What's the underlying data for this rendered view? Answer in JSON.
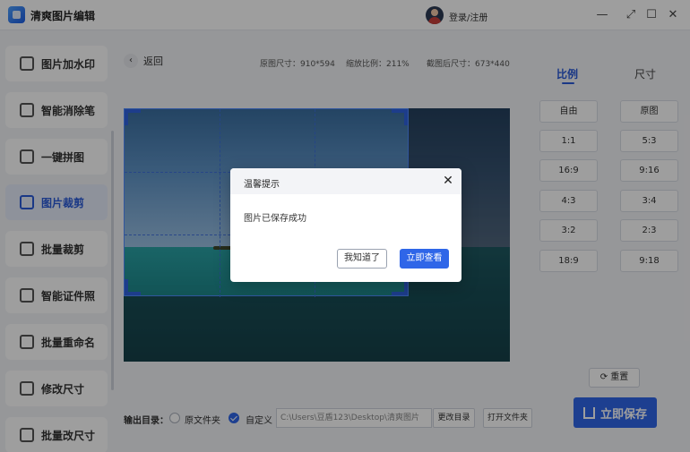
{
  "app": {
    "title": "清爽图片编辑",
    "login": "登录/注册"
  },
  "window": {
    "min": "—",
    "restore": "⤢",
    "max": "☐",
    "close": "✕"
  },
  "sidebar": {
    "items": [
      {
        "label": "图片加水印",
        "icon": "watermark-icon"
      },
      {
        "label": "智能消除笔",
        "icon": "eraser-icon"
      },
      {
        "label": "一键拼图",
        "icon": "collage-icon"
      },
      {
        "label": "图片裁剪",
        "icon": "crop-icon",
        "active": true
      },
      {
        "label": "批量裁剪",
        "icon": "batch-crop-icon"
      },
      {
        "label": "智能证件照",
        "icon": "id-photo-icon"
      },
      {
        "label": "批量重命名",
        "icon": "rename-icon"
      },
      {
        "label": "修改尺寸",
        "icon": "resize-icon"
      },
      {
        "label": "批量改尺寸",
        "icon": "batch-resize-icon"
      }
    ]
  },
  "toolbar": {
    "back": "返回",
    "original_size": "原图尺寸：910*594",
    "zoom": "缩放比例：211%",
    "cropped_size": "截图后尺寸：673*440"
  },
  "tabs": {
    "ratio": "比例",
    "size": "尺寸"
  },
  "ratios": [
    "自由",
    "原图",
    "1:1",
    "5:3",
    "16:9",
    "9:16",
    "4:3",
    "3:4",
    "3:2",
    "2:3",
    "18:9",
    "9:18"
  ],
  "actions": {
    "reset": "重置",
    "save": "立即保存"
  },
  "output": {
    "label": "输出目录：",
    "option_original": "原文件夹",
    "option_custom": "自定义",
    "path": "C:\\Users\\豆盾123\\Desktop\\清爽图片",
    "change_dir": "更改目录",
    "open_folder": "打开文件夹"
  },
  "dialog": {
    "title": "温馨提示",
    "message": "图片已保存成功",
    "ok": "我知道了",
    "view": "立即查看",
    "close": "✕"
  },
  "colors": {
    "accent": "#2f66e8"
  }
}
